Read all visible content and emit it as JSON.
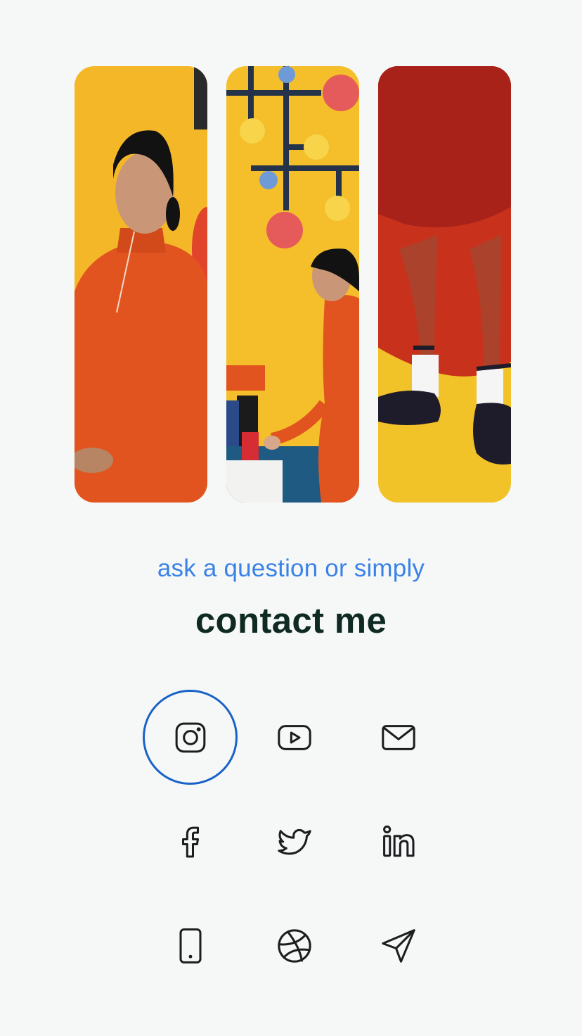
{
  "gallery": {
    "photos": [
      {
        "name": "woman-seated-orange-dress-photo"
      },
      {
        "name": "woman-with-mobile-sculpture-photo"
      },
      {
        "name": "legs-with-shoes-photo"
      }
    ]
  },
  "contact": {
    "subtitle": "ask a question or simply",
    "title": "contact me"
  },
  "social": [
    {
      "icon": "instagram-icon",
      "active": true
    },
    {
      "icon": "youtube-icon",
      "active": false
    },
    {
      "icon": "mail-icon",
      "active": false
    },
    {
      "icon": "facebook-icon",
      "active": false
    },
    {
      "icon": "twitter-icon",
      "active": false
    },
    {
      "icon": "linkedin-icon",
      "active": false
    },
    {
      "icon": "phone-icon",
      "active": false
    },
    {
      "icon": "dribbble-icon",
      "active": false
    },
    {
      "icon": "send-icon",
      "active": false
    }
  ],
  "colors": {
    "background": "#f6f8f8",
    "accent": "#3b82e6",
    "title": "#0f2a22",
    "ring": "#1a62c7"
  }
}
